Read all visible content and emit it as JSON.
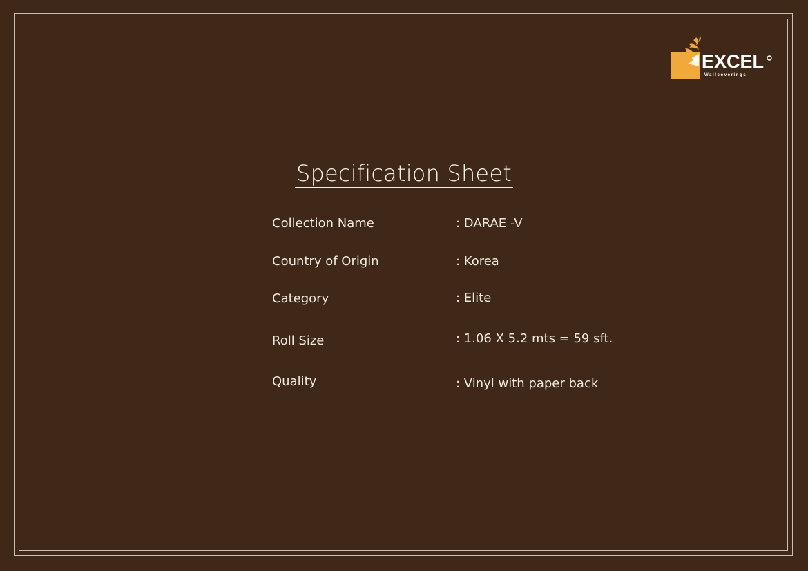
{
  "brand": {
    "name": "EXCEL",
    "tagline": "Wallcoverings",
    "accent_color": "#f2a93b"
  },
  "title": "Specification Sheet",
  "specs": [
    {
      "label": "Collection Name",
      "value": ": DARAE -V"
    },
    {
      "label": "Country of Origin",
      "value": ": Korea"
    },
    {
      "label": "Category",
      "value": ": Elite"
    },
    {
      "label": "Roll Size",
      "value": ": 1.06 X 5.2 mts = 59 sft."
    },
    {
      "label": "Quality",
      "value": ": Vinyl with paper back"
    }
  ],
  "colors": {
    "background": "#3f2818",
    "border": "#cbbfb2",
    "text": "#efe7de"
  }
}
